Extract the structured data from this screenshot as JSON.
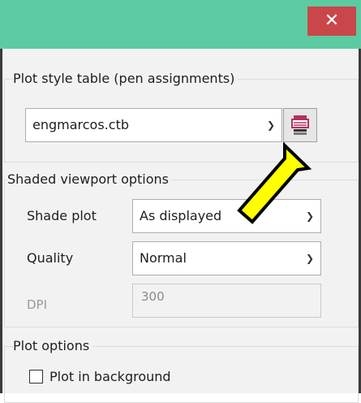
{
  "window": {
    "close_glyph": "✕",
    "accent_titlebar": "#5ccba2",
    "accent_close": "#c9474a"
  },
  "plot_style_table": {
    "group_title": "Plot style table (pen assignments)",
    "selected": "engmarcos.ctb",
    "edit_icon": "edit-plot-style-icon"
  },
  "shaded_viewport": {
    "group_title": "Shaded viewport options",
    "shade_plot_label": "Shade plot",
    "shade_plot_value": "As displayed",
    "quality_label": "Quality",
    "quality_value": "Normal",
    "dpi_label": "DPI",
    "dpi_value": "300"
  },
  "plot_options": {
    "group_title": "Plot options",
    "plot_in_background_label": "Plot in background",
    "plot_in_background_checked": false
  },
  "annotation": {
    "arrow_color": "#ffff00",
    "arrow_icon": "yellow-arrow-icon"
  }
}
